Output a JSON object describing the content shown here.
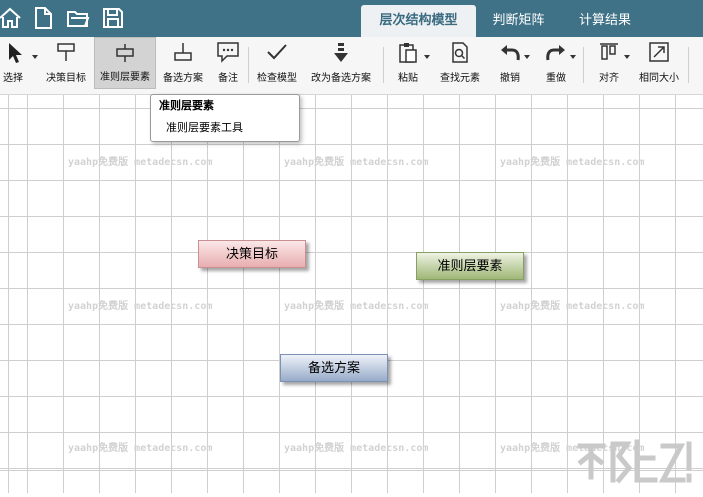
{
  "quick_access": [
    {
      "icon": "home-icon"
    },
    {
      "icon": "new-file-icon"
    },
    {
      "icon": "open-folder-icon"
    },
    {
      "icon": "save-icon"
    }
  ],
  "tabs": [
    {
      "label": "层次结构模型",
      "active": true
    },
    {
      "label": "判断矩阵",
      "active": false
    },
    {
      "label": "计算结果",
      "active": false
    }
  ],
  "toolbar": {
    "select": "选择",
    "decision_goal": "决策目标",
    "criteria_element": "准则层要素",
    "alternative": "备选方案",
    "note": "备注",
    "check_model": "检查模型",
    "change_to_alternative": "改为备选方案",
    "paste": "粘贴",
    "find_element": "查找元素",
    "undo": "撤销",
    "redo": "重做",
    "align": "对齐",
    "same_size": "相同大小"
  },
  "tooltip": {
    "title": "准则层要素",
    "description": "准则层要素工具"
  },
  "watermark": "yaahp免费版 metadecsn.com",
  "nodes": {
    "goal": "决策目标",
    "criteria": "准则层要素",
    "alternative": "备选方案"
  },
  "colors": {
    "titlebar": "#3f7286",
    "goal_node": "#e8aeb0",
    "criteria_node": "#9fb777",
    "alternative_node": "#97abc9"
  }
}
